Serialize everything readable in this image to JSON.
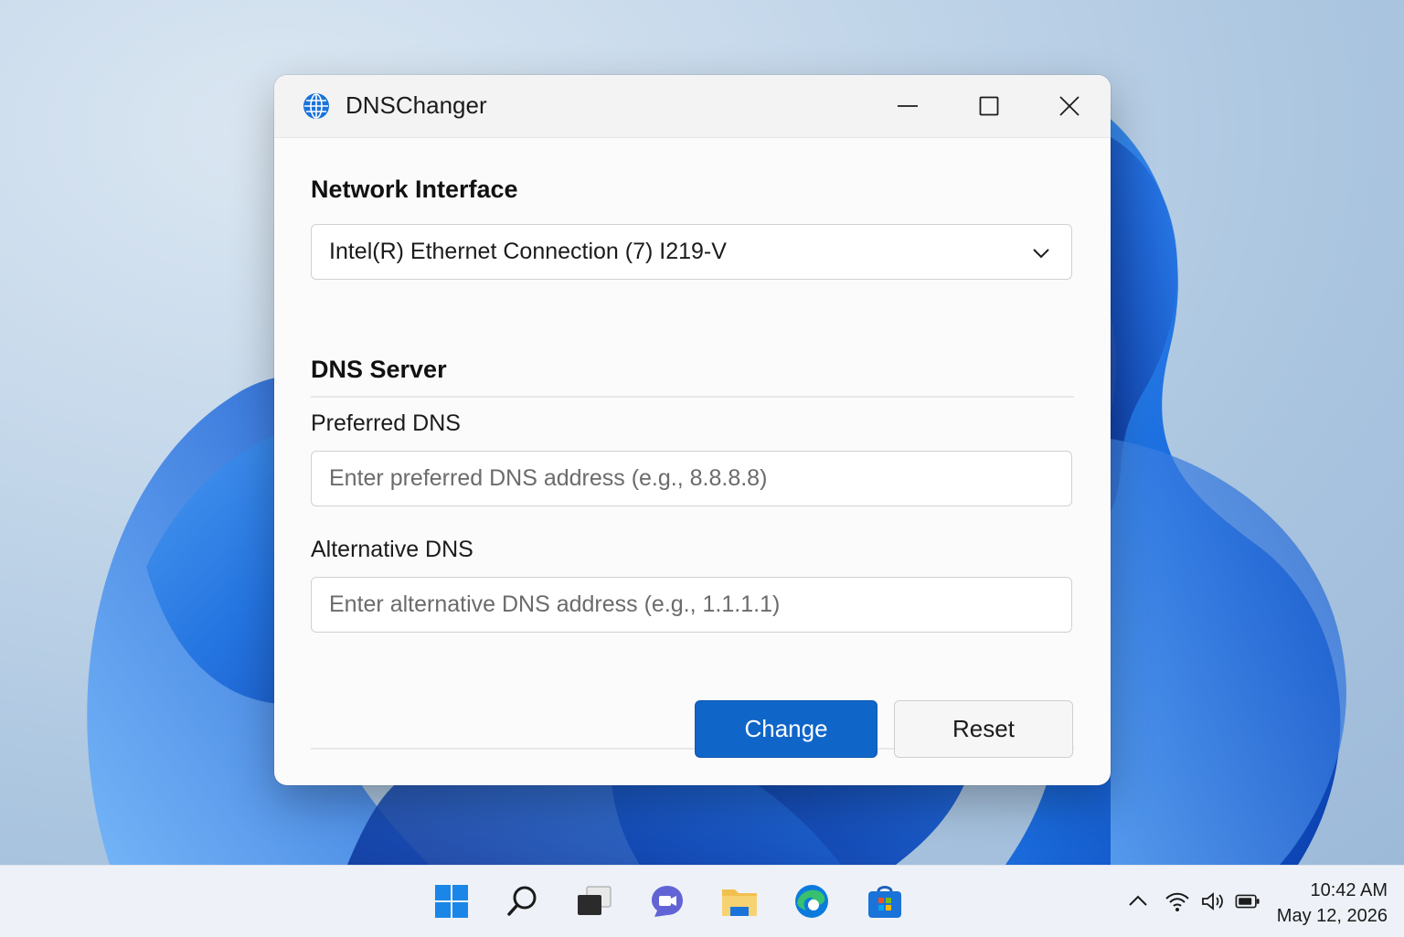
{
  "window": {
    "title": "DNSChanger",
    "icon": "globe-icon",
    "controls": [
      "minimize-icon",
      "maximize-icon",
      "close-icon"
    ]
  },
  "network_interface": {
    "heading": "Network Interface",
    "selected": "Intel(R) Ethernet Connection (7) I219-V"
  },
  "dns_server": {
    "heading": "DNS Server",
    "preferred_label": "Preferred DNS",
    "preferred_value": "",
    "preferred_placeholder": "Enter preferred DNS address (e.g., 8.8.8.8)",
    "alternative_label": "Alternative DNS",
    "alternative_value": "",
    "alternative_placeholder": "Enter alternative DNS address (e.g., 1.1.1.1)"
  },
  "actions": {
    "change_label": "Change",
    "reset_label": "Reset"
  },
  "taskbar": {
    "apps": [
      "start-icon",
      "search-icon",
      "task-view-icon",
      "chat-icon",
      "file-explorer-icon",
      "edge-icon",
      "store-icon"
    ],
    "tray": [
      "chevron-up-icon",
      "wifi-icon",
      "speaker-icon",
      "battery-icon"
    ],
    "time": "10:42 AM",
    "date": "May 12, 2026"
  },
  "colors": {
    "accent": "#1065c9",
    "window_bg": "#fbfbfb",
    "taskbar_bg": "#eef2f8"
  }
}
